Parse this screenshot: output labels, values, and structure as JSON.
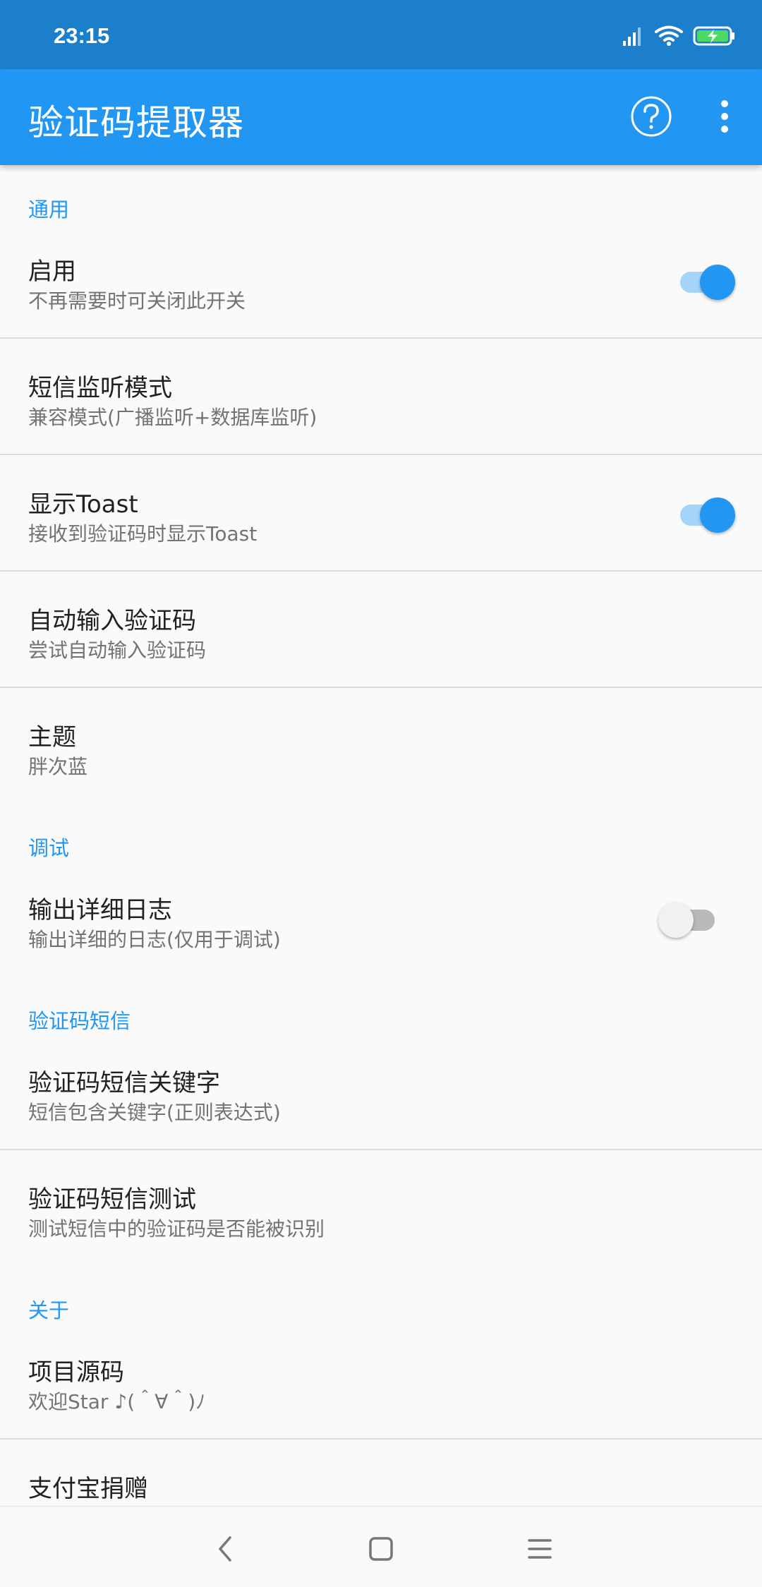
{
  "status_bar": {
    "time": "23:15",
    "icons": [
      "signal-icon",
      "wifi-icon",
      "battery-charging-icon"
    ]
  },
  "app_bar": {
    "title": "验证码提取器",
    "actions": [
      "help-icon",
      "more-vert-icon"
    ]
  },
  "colors": {
    "status_bar": "#1b7fcc",
    "accent": "#2196f3",
    "background": "#fafafa"
  },
  "sections": {
    "general": {
      "header": "通用",
      "enable": {
        "title": "启用",
        "summary": "不再需要时可关闭此开关",
        "checked": true
      },
      "listen_mode": {
        "title": "短信监听模式",
        "summary": "兼容模式(广播监听+数据库监听)"
      },
      "show_toast": {
        "title": "显示Toast",
        "summary": "接收到验证码时显示Toast",
        "checked": true
      },
      "auto_input": {
        "title": "自动输入验证码",
        "summary": "尝试自动输入验证码"
      },
      "theme": {
        "title": "主题",
        "summary": "胖次蓝"
      }
    },
    "debug": {
      "header": "调试",
      "verbose_log": {
        "title": "输出详细日志",
        "summary": "输出详细的日志(仅用于调试)",
        "checked": false
      }
    },
    "sms": {
      "header": "验证码短信",
      "keywords": {
        "title": "验证码短信关键字",
        "summary": "短信包含关键字(正则表达式)"
      },
      "test": {
        "title": "验证码短信测试",
        "summary": "测试短信中的验证码是否能被识别"
      }
    },
    "about": {
      "header": "关于",
      "source_code": {
        "title": "项目源码",
        "summary": "欢迎Star ♪(＾∀＾)ﾉ"
      },
      "donate": {
        "title": "支付宝捐赠"
      }
    }
  },
  "nav_bar": [
    "back-icon",
    "home-icon",
    "recents-icon"
  ]
}
